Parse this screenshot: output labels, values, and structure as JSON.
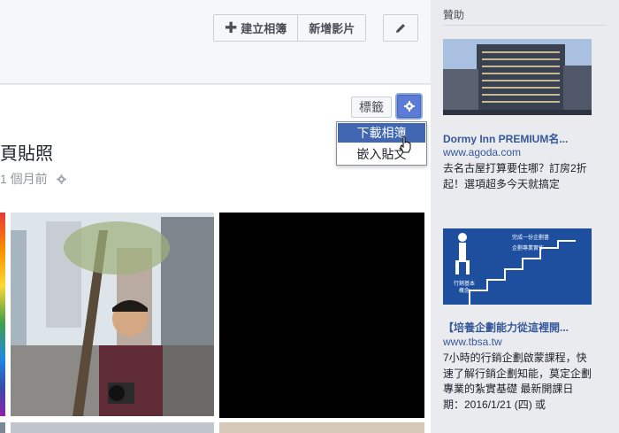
{
  "header": {
    "create_album_label": "建立相簿",
    "add_video_label": "新增影片"
  },
  "album": {
    "tag_label": "標籤",
    "title": "頁貼照",
    "meta_time": "1 個月前",
    "menu": [
      {
        "label": "下載相簿"
      },
      {
        "label": "嵌入貼文"
      }
    ]
  },
  "sidebar": {
    "heading": "贊助",
    "ads": [
      {
        "title": "Dormy Inn PREMIUM名...",
        "url": "www.agoda.com",
        "body": "去名古屋打算要住哪？訂房2折起！選項超多今天就搞定"
      },
      {
        "title": "【培養企劃能力從這裡開...",
        "url": "www.tbsa.tw",
        "body": "7小時的行銷企劃啟蒙課程，快速了解行銷企劃知能，莫定企劃專業的紮實基礎 最新開課日期：2016/1/21 (四) 或"
      }
    ],
    "ad2_image_text": {
      "top_line1": "完成一份企劃書",
      "top_line2": "企劃專業實作",
      "bottom_line1": "行銷基本",
      "bottom_line2": "概念"
    }
  },
  "colors": {
    "accent": "#4267b2",
    "link": "#365899",
    "ad2_bg": "#1d4f9e"
  },
  "icons": [
    "plus-icon",
    "pencil-icon",
    "gear-icon",
    "hand-cursor-icon"
  ]
}
